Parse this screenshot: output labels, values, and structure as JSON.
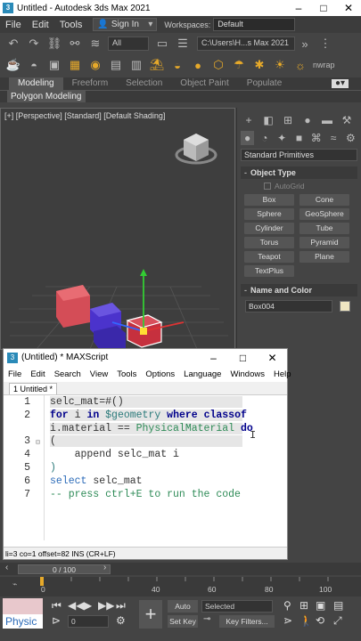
{
  "window": {
    "title": "Untitled - Autodesk 3ds Max 2021"
  },
  "menubar": {
    "items": [
      "File",
      "Edit",
      "Tools"
    ],
    "signin": "Sign In",
    "workspaces_label": "Workspaces:",
    "workspace_value": "Default"
  },
  "toolbar": {
    "selection_filter": "All",
    "path_field": "C:\\Users\\H...s Max 2021",
    "overflow": "nwrap"
  },
  "ribbon": {
    "tabs": [
      "Modeling",
      "Freeform",
      "Selection",
      "Object Paint",
      "Populate"
    ],
    "active": "Modeling",
    "sub": "Polygon Modeling"
  },
  "viewport": {
    "label": "[+] [Perspective] [Standard] [Default Shading]"
  },
  "command_panel": {
    "category": "Standard Primitives",
    "object_type": "Object Type",
    "autogrid": "AutoGrid",
    "buttons": [
      "Box",
      "Cone",
      "Sphere",
      "GeoSphere",
      "Cylinder",
      "Tube",
      "Torus",
      "Pyramid",
      "Teapot",
      "Plane",
      "TextPlus"
    ],
    "name_and_color": "Name and Color",
    "object_name": "Box004",
    "object_color": "#efe6c2"
  },
  "maxscript": {
    "title": "(Untitled) * MAXScript",
    "menu": [
      "File",
      "Edit",
      "Search",
      "View",
      "Tools",
      "Options",
      "Language",
      "Windows",
      "Help"
    ],
    "tab": "1 Untitled *",
    "line_numbers": [
      "1",
      "2",
      "3",
      "4",
      "5",
      "6",
      "7"
    ],
    "code": {
      "l1": "selc_mat=#()",
      "l2a": "for",
      "l2b": " i ",
      "l2c": "in",
      "l2d": " $geometry ",
      "l2e": "where classof",
      "l2f": "i.material == ",
      "l2g": "PhysicalMaterial",
      "l2h": " do",
      "l3": "(",
      "l4": "    append selc_mat i",
      "l5": ")",
      "l6a": "select",
      "l6b": " selc_mat",
      "l7": "-- press ctrl+E to run the code"
    },
    "status": "li=3 co=1 offset=82 INS (CR+LF)"
  },
  "timeline": {
    "frame": "0 / 100",
    "ticks": [
      "0",
      "40",
      "60",
      "80",
      "100"
    ]
  },
  "bottom": {
    "mini_listener": "Physic",
    "frame_field": "0",
    "auto_key": "Auto Key",
    "set_key": "Set Key",
    "selected": "Selected",
    "key_filters": "Key Filters..."
  }
}
